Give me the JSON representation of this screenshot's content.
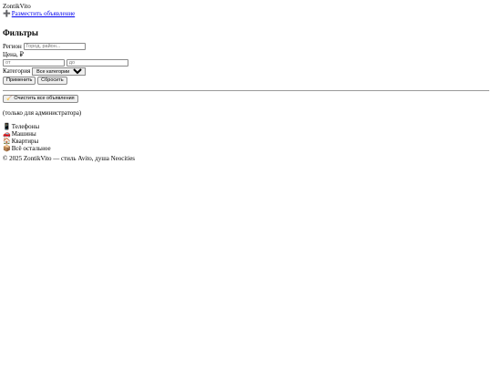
{
  "header": {
    "site_name": "ZontikVito",
    "post_link_icon": "heavy-plus-icon",
    "post_link_glyph": "➕",
    "post_link_label": "Разместить объявление"
  },
  "filters": {
    "title": "Фильтры",
    "region_label": "Регион",
    "region_placeholder": "Город, район...",
    "region_value": "",
    "price_label": "Цена, ₽",
    "price_from_placeholder": "от",
    "price_to_placeholder": "до",
    "category_label": "Категория",
    "category_selected": "Все категории",
    "apply_label": "Применить",
    "reset_label": "Сбросить"
  },
  "admin": {
    "clear_icon": "broom-icon",
    "clear_glyph": "🧹",
    "clear_label": "Очистить все объявления",
    "note": "(только для администратора)"
  },
  "categories": [
    {
      "icon": "phone-icon",
      "glyph": "📱",
      "label": "Телефоны"
    },
    {
      "icon": "car-icon",
      "glyph": "🚗",
      "label": "Машины"
    },
    {
      "icon": "house-icon",
      "glyph": "🏠",
      "label": "Квартиры"
    },
    {
      "icon": "package-icon",
      "glyph": "📦",
      "label": "Всё остальное"
    }
  ],
  "footer": {
    "text": "© 2025 ZontikVito — стиль Avito, душа Neocities"
  }
}
